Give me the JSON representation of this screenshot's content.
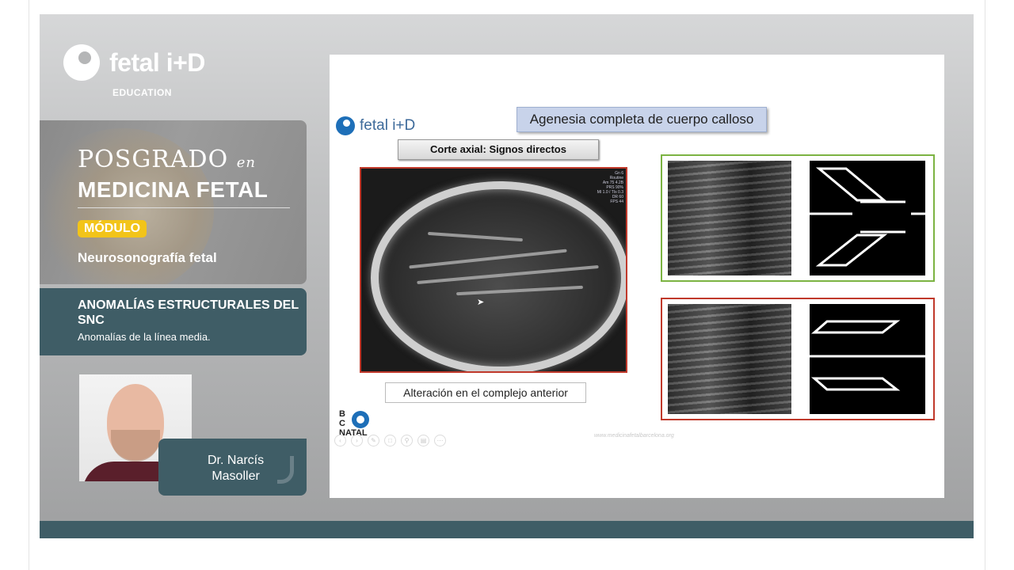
{
  "brand": {
    "name": "fetal i+D",
    "subtitle": "EDUCATION"
  },
  "course": {
    "program_script": "POSGRADO",
    "program_en": "en",
    "program_title": "MEDICINA FETAL",
    "module_label": "MÓDULO",
    "module_name": "Neurosonografía fetal"
  },
  "topic": {
    "title": "ANOMALÍAS ESTRUCTURALES DEL SNC",
    "subtitle": "Anomalías de la línea media."
  },
  "presenter": {
    "name_line1": "Dr. Narcís",
    "name_line2": "Masoller"
  },
  "slide": {
    "logo_text": "fetal i+D",
    "title": "Agenesia completa de cuerpo calloso",
    "subtitle": "Corte axial: Signos directos",
    "caption": "Alteración en el complejo anterior",
    "footer_logo_top": "B",
    "footer_logo_mid": "C",
    "footer_logo_bottom": "NATAL",
    "footer_url": "www.medicinafetalbarcelona.org",
    "ultrasound_info": "Gn 6\nRoutine\nAm 75 4.2B\nPRS 90%\nMI 1.0 / TIs 0.3\nDR 60\nFPS 44",
    "panel_colors": {
      "correct": "#7cb342",
      "altered": "#c0392b"
    }
  },
  "icons": [
    "brand-logo-icon",
    "cursor-icon",
    "bcnatal-eye-icon",
    "player-control-icons"
  ]
}
